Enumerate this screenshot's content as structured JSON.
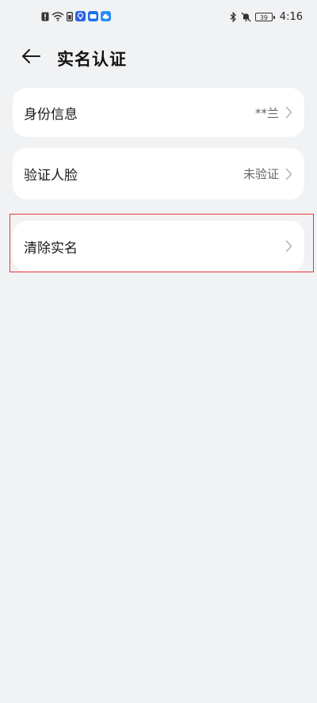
{
  "status_bar": {
    "time": "4:16",
    "battery": "39"
  },
  "header": {
    "title": "实名认证"
  },
  "rows": [
    {
      "label": "身份信息",
      "value": "**兰"
    },
    {
      "label": "验证人脸",
      "value": "未验证"
    },
    {
      "label": "清除实名",
      "value": ""
    }
  ],
  "colors": {
    "background": "#f1f2f4",
    "card": "#ffffff",
    "highlight": "#e53935"
  }
}
